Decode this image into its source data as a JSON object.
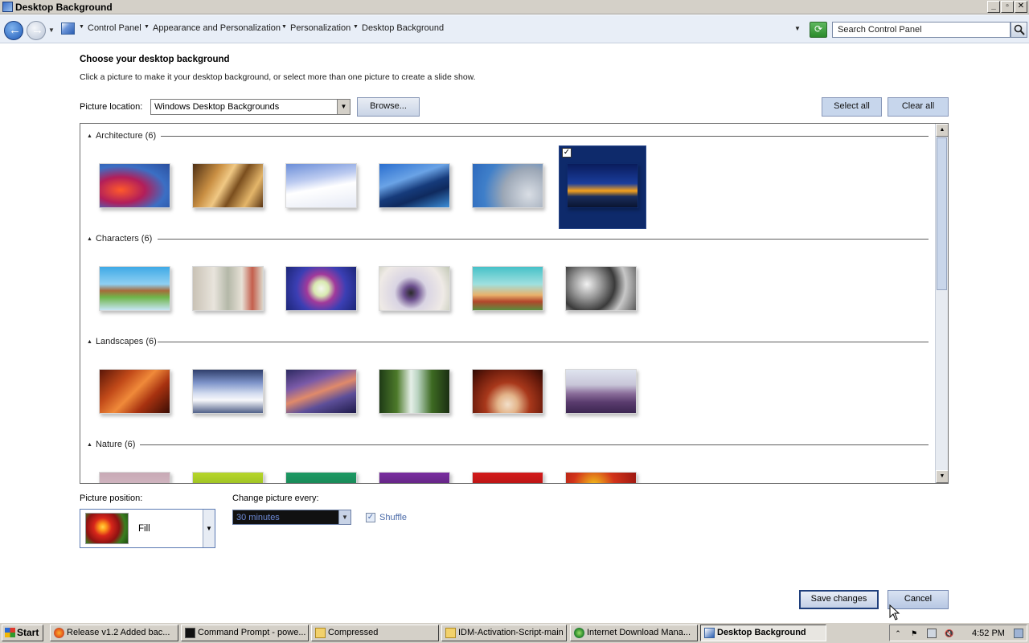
{
  "window": {
    "title": "Desktop Background"
  },
  "address": {
    "crumbs": [
      "Control Panel",
      "Appearance and Personalization",
      "Personalization",
      "Desktop Background"
    ],
    "search_placeholder": "Search Control Panel"
  },
  "page": {
    "heading": "Choose your desktop background",
    "subtext": "Click a picture to make it your desktop background, or select more than one picture to create a slide show.",
    "location_label": "Picture location:",
    "location_value": "Windows Desktop Backgrounds",
    "browse_label": "Browse...",
    "select_all_label": "Select all",
    "clear_all_label": "Clear all"
  },
  "gallery": {
    "groups": [
      {
        "label": "Architecture (6)",
        "selected_index": 5
      },
      {
        "label": "Characters (6)",
        "selected_index": null
      },
      {
        "label": "Landscapes (6)",
        "selected_index": null
      },
      {
        "label": "Nature (6)",
        "selected_index": null
      }
    ]
  },
  "controls": {
    "position_label": "Picture position:",
    "position_value": "Fill",
    "change_label": "Change picture every:",
    "change_value": "30 minutes",
    "shuffle_label": "Shuffle",
    "shuffle_checked": true
  },
  "actions": {
    "save_label": "Save changes",
    "cancel_label": "Cancel"
  },
  "taskbar": {
    "start_label": "Start",
    "tasks": [
      "Release v1.2 Added bac...",
      "Command Prompt - powe...",
      "Compressed",
      "IDM-Activation-Script-main",
      "Internet Download Mana...",
      "Desktop Background"
    ],
    "clock": "4:52 PM"
  }
}
